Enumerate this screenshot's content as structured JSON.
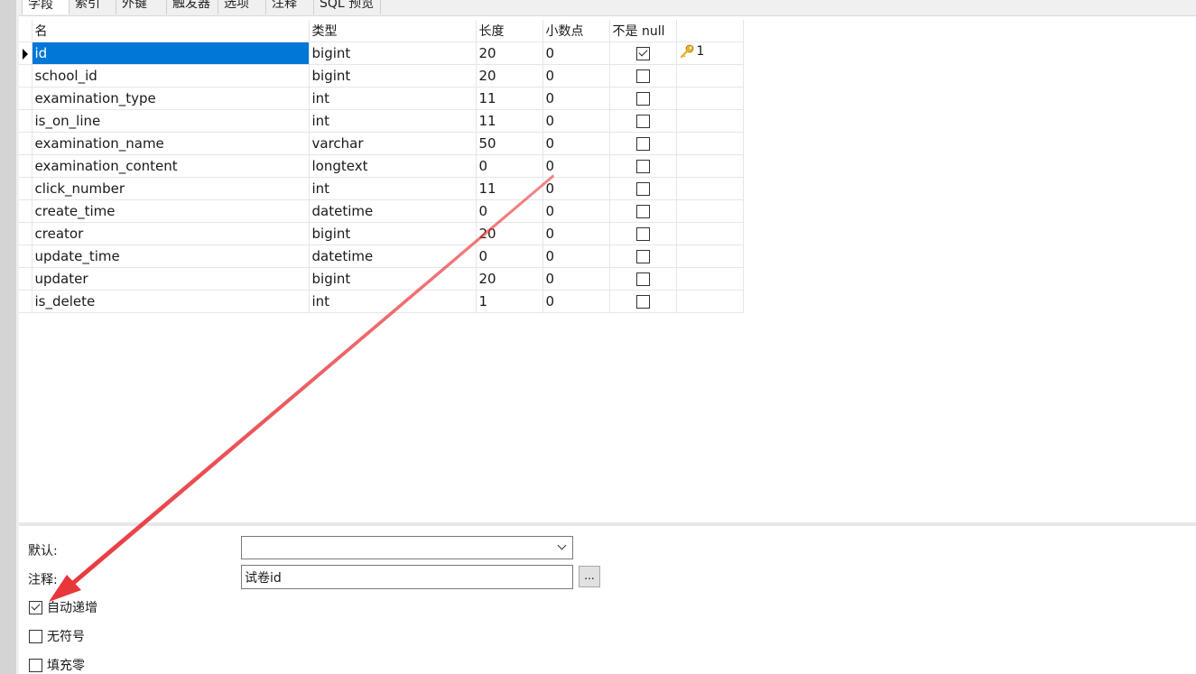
{
  "tabs": [
    "字段",
    "索引",
    "外键",
    "触发器",
    "选项",
    "注释",
    "SQL 预览"
  ],
  "grid": {
    "headers": [
      "名",
      "类型",
      "长度",
      "小数点",
      "不是 null"
    ],
    "rows": [
      {
        "name": "id",
        "type": "bigint",
        "length": "20",
        "decimals": "0",
        "not_null": true,
        "key": "1"
      },
      {
        "name": "school_id",
        "type": "bigint",
        "length": "20",
        "decimals": "0",
        "not_null": false,
        "key": ""
      },
      {
        "name": "examination_type",
        "type": "int",
        "length": "11",
        "decimals": "0",
        "not_null": false,
        "key": ""
      },
      {
        "name": "is_on_line",
        "type": "int",
        "length": "11",
        "decimals": "0",
        "not_null": false,
        "key": ""
      },
      {
        "name": "examination_name",
        "type": "varchar",
        "length": "50",
        "decimals": "0",
        "not_null": false,
        "key": ""
      },
      {
        "name": "examination_content",
        "type": "longtext",
        "length": "0",
        "decimals": "0",
        "not_null": false,
        "key": ""
      },
      {
        "name": "click_number",
        "type": "int",
        "length": "11",
        "decimals": "0",
        "not_null": false,
        "key": ""
      },
      {
        "name": "create_time",
        "type": "datetime",
        "length": "0",
        "decimals": "0",
        "not_null": false,
        "key": ""
      },
      {
        "name": "creator",
        "type": "bigint",
        "length": "20",
        "decimals": "0",
        "not_null": false,
        "key": ""
      },
      {
        "name": "update_time",
        "type": "datetime",
        "length": "0",
        "decimals": "0",
        "not_null": false,
        "key": ""
      },
      {
        "name": "updater",
        "type": "bigint",
        "length": "20",
        "decimals": "0",
        "not_null": false,
        "key": ""
      },
      {
        "name": "is_delete",
        "type": "int",
        "length": "1",
        "decimals": "0",
        "not_null": false,
        "key": ""
      }
    ]
  },
  "props": {
    "default_label": "默认:",
    "default_value": "",
    "comment_label": "注释:",
    "comment_value": "试卷id",
    "ellipsis_label": "...",
    "auto_increment_label": "自动递增",
    "auto_increment_checked": true,
    "unsigned_label": "无符号",
    "unsigned_checked": false,
    "zerofill_label": "填充零",
    "zerofill_checked": false
  },
  "colors": {
    "selection": "#0078d7",
    "annotation_arrow": "#e8363b",
    "key_icon": "#e8b530"
  },
  "icons": {
    "row_marker": "current-row-triangle",
    "primary_key": "key-icon"
  }
}
